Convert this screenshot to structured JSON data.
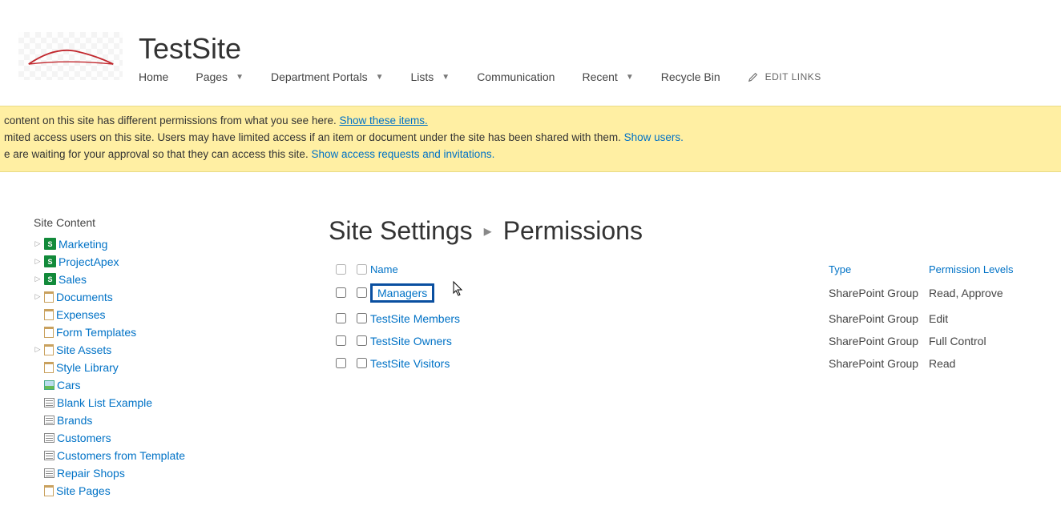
{
  "site_title": "TestSite",
  "top_nav": {
    "items": [
      {
        "label": "Home",
        "dropdown": false
      },
      {
        "label": "Pages",
        "dropdown": true
      },
      {
        "label": "Department Portals",
        "dropdown": true
      },
      {
        "label": "Lists",
        "dropdown": true
      },
      {
        "label": "Communication",
        "dropdown": false
      },
      {
        "label": "Recent",
        "dropdown": true
      },
      {
        "label": "Recycle Bin",
        "dropdown": false
      }
    ],
    "edit_links": "EDIT LINKS"
  },
  "notice": {
    "line1_pre": " content on this site has different permissions from what you see here.  ",
    "line1_link": "Show these items.",
    "line2_pre": "mited access users on this site. Users may have limited access if an item or document under the site has been shared with them. ",
    "line2_link": "Show users.",
    "line3_pre": "e are waiting for your approval so that they can access this site. ",
    "line3_link": "Show access requests and invitations."
  },
  "sidebar": {
    "title": "Site Content",
    "items": [
      {
        "label": "Marketing",
        "expandable": true,
        "icon": "sp"
      },
      {
        "label": "ProjectApex",
        "expandable": true,
        "icon": "sp"
      },
      {
        "label": "Sales",
        "expandable": true,
        "icon": "sp"
      },
      {
        "label": "Documents",
        "expandable": true,
        "icon": "doc"
      },
      {
        "label": "Expenses",
        "expandable": false,
        "icon": "doc"
      },
      {
        "label": "Form Templates",
        "expandable": false,
        "icon": "doc"
      },
      {
        "label": "Site Assets",
        "expandable": true,
        "icon": "doc"
      },
      {
        "label": "Style Library",
        "expandable": false,
        "icon": "doc"
      },
      {
        "label": "Cars",
        "expandable": false,
        "icon": "img"
      },
      {
        "label": "Blank List Example",
        "expandable": false,
        "icon": "list"
      },
      {
        "label": "Brands",
        "expandable": false,
        "icon": "list"
      },
      {
        "label": "Customers",
        "expandable": false,
        "icon": "list"
      },
      {
        "label": "Customers from Template",
        "expandable": false,
        "icon": "list"
      },
      {
        "label": "Repair Shops",
        "expandable": false,
        "icon": "list"
      },
      {
        "label": "Site Pages",
        "expandable": false,
        "icon": "doc"
      }
    ]
  },
  "breadcrumb": {
    "level1": "Site Settings",
    "level2": "Permissions"
  },
  "table": {
    "headers": {
      "name": "Name",
      "type": "Type",
      "perm": "Permission Levels"
    },
    "rows": [
      {
        "name": "Managers",
        "type": "SharePoint Group",
        "perm": "Read, Approve",
        "highlighted": true
      },
      {
        "name": "TestSite Members",
        "type": "SharePoint Group",
        "perm": "Edit",
        "highlighted": false
      },
      {
        "name": "TestSite Owners",
        "type": "SharePoint Group",
        "perm": "Full Control",
        "highlighted": false
      },
      {
        "name": "TestSite Visitors",
        "type": "SharePoint Group",
        "perm": "Read",
        "highlighted": false
      }
    ]
  }
}
